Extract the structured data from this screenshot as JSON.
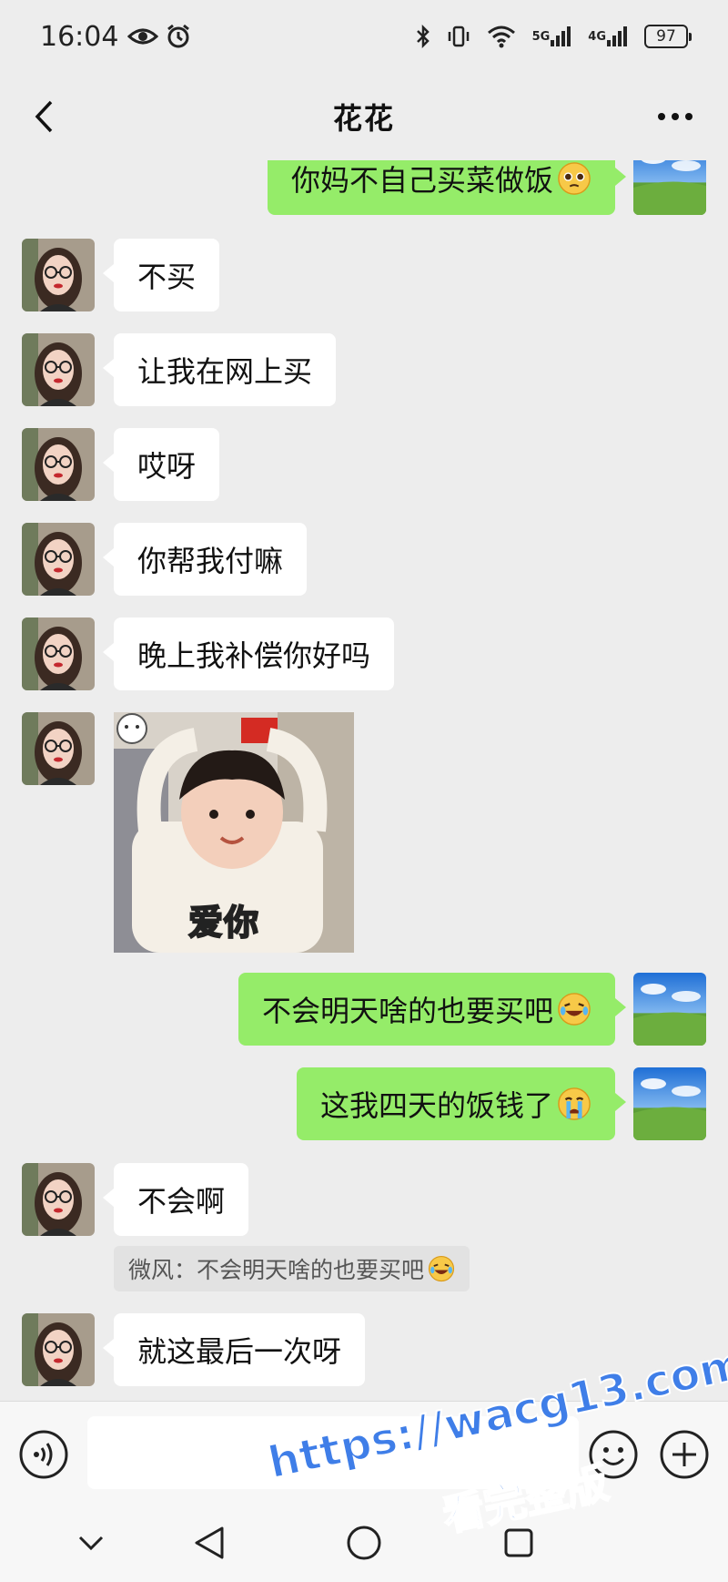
{
  "status_bar": {
    "time": "16:04",
    "icons": [
      "eye-icon",
      "alarm-icon",
      "bluetooth-icon",
      "vibrate-icon",
      "wifi-icon"
    ],
    "net1": "5G",
    "net2": "4G",
    "battery": "97"
  },
  "header": {
    "title": "花花",
    "back_icon": "chevron-left-icon",
    "more_icon": "more-dots-icon"
  },
  "messages": [
    {
      "side": "right",
      "text": "你妈不自己买菜做饭",
      "emoji": "pleading-face"
    },
    {
      "side": "left",
      "text": "不买"
    },
    {
      "side": "left",
      "text": "让我在网上买"
    },
    {
      "side": "left",
      "text": "哎呀"
    },
    {
      "side": "left",
      "text": "你帮我付嘛"
    },
    {
      "side": "left",
      "text": "晚上我补偿你好吗"
    },
    {
      "side": "left",
      "type": "sticker",
      "caption": "爱你"
    },
    {
      "side": "right",
      "text": "不会明天啥的也要买吧",
      "emoji": "rolling-laugh"
    },
    {
      "side": "right",
      "text": "这我四天的饭钱了",
      "emoji": "crying-face"
    },
    {
      "side": "left",
      "text": "不会啊"
    },
    {
      "side": "left",
      "type": "quote",
      "text": "微风：不会明天啥的也要买吧",
      "emoji": "rolling-laugh"
    },
    {
      "side": "left",
      "text": "就这最后一次呀"
    }
  ],
  "input_bar": {
    "placeholder": "",
    "voice_icon": "voice-icon",
    "emoji_icon": "emoji-icon",
    "plus_icon": "plus-icon"
  },
  "system_nav": [
    "chevron-down-icon",
    "back-triangle-icon",
    "home-circle-icon",
    "recents-square-icon"
  ],
  "watermark": {
    "url": "https://wacg13.com",
    "subtitle": "看完整版"
  },
  "colors": {
    "background": "#ededed",
    "bubble_self": "#95ec69",
    "bubble_other": "#ffffff",
    "watermark": "#3f7ee8"
  }
}
